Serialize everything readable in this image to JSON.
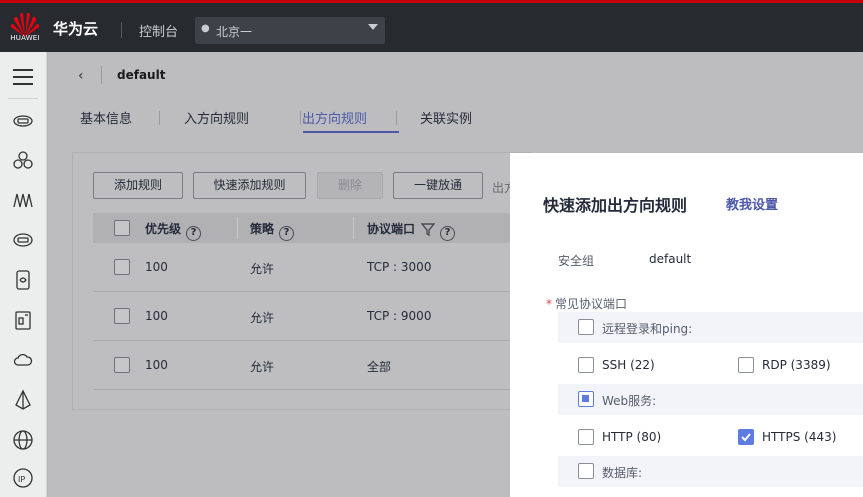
{
  "topbar": {
    "logo_text": "HUAWEI",
    "brand": "华为云",
    "console": "控制台",
    "region": "北京一",
    "accent_color": "#c7000b"
  },
  "sidebar": {
    "icons": [
      "menu-icon",
      "cloud-server-icon",
      "cluster-icon",
      "network-icon",
      "storage-icon",
      "database-icon",
      "container-icon",
      "cloud-icon",
      "deploy-icon",
      "web-icon",
      "ip-icon"
    ]
  },
  "page": {
    "title": "default",
    "tabs": [
      {
        "label": "基本信息",
        "active": false
      },
      {
        "label": "入方向规则",
        "active": false
      },
      {
        "label": "出方向规则",
        "active": true
      },
      {
        "label": "关联实例",
        "active": false
      }
    ],
    "toolbar": {
      "add_rule": "添加规则",
      "quick_add": "快速添加规则",
      "delete": "删除",
      "allow_all": "一键放通",
      "cut_text": "出方"
    },
    "table": {
      "headers": {
        "priority": "优先级",
        "policy": "策略",
        "protocol_port": "协议端口"
      },
      "rows": [
        {
          "priority": "100",
          "policy": "允许",
          "protocol": "TCP : 3000"
        },
        {
          "priority": "100",
          "policy": "允许",
          "protocol": "TCP : 9000"
        },
        {
          "priority": "100",
          "policy": "允许",
          "protocol": "全部"
        }
      ]
    }
  },
  "panel": {
    "title": "快速添加出方向规则",
    "help_link": "教我设置",
    "security_group_label": "安全组",
    "security_group_value": "default",
    "ports_label": "常见协议端口",
    "groups": [
      {
        "label": "远程登录和ping:",
        "state": "unchecked",
        "options": [
          {
            "label": "SSH (22)",
            "checked": false
          },
          {
            "label": "RDP (3389)",
            "checked": false
          }
        ]
      },
      {
        "label": "Web服务:",
        "state": "partial",
        "options": [
          {
            "label": "HTTP (80)",
            "checked": false
          },
          {
            "label": "HTTPS (443)",
            "checked": true
          }
        ]
      },
      {
        "label": "数据库:",
        "state": "unchecked",
        "options": []
      }
    ],
    "accent_color": "#5e7ce0"
  }
}
